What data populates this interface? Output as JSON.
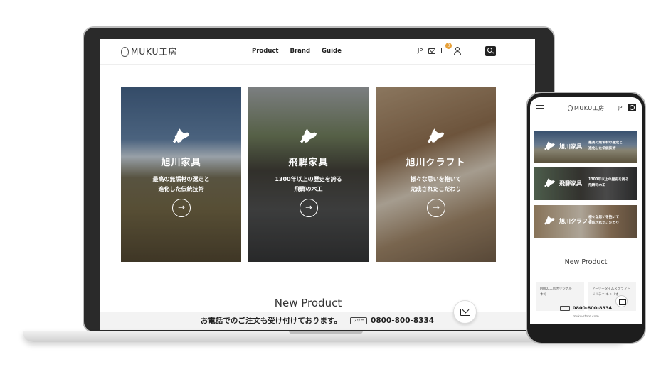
{
  "laptop": {
    "header": {
      "logo_text": "MUKU工房",
      "nav": [
        "Product",
        "Brand",
        "Guide"
      ],
      "lang": "JP",
      "cart_count": "0",
      "icons": [
        "mail-icon",
        "cart-icon",
        "user-icon",
        "search-icon"
      ]
    },
    "cards": [
      {
        "title": "旭川家具",
        "desc_line1": "最高の無垢材の選定と",
        "desc_line2": "進化した伝統技術",
        "arrow": "→"
      },
      {
        "title": "飛騨家具",
        "desc_line1": "1300年以上の歴史を誇る",
        "desc_line2": "飛騨の木工",
        "arrow": "→"
      },
      {
        "title": "旭川クラフト",
        "desc_line1": "様々な思いを抱いて",
        "desc_line2": "完成されたこだわり",
        "arrow": "→"
      }
    ],
    "new_product_title": "New Product",
    "phone_order": {
      "text": "お電話でのご注文も受け付けております。",
      "tel_icon_text": "フリー",
      "number": "0800-800-8334"
    }
  },
  "phone": {
    "logo_text": "MUKU工房",
    "lang": "JP",
    "cards": [
      {
        "title": "旭川家具",
        "desc_line1": "最高の無垢材の選定と",
        "desc_line2": "進化した伝統技術"
      },
      {
        "title": "飛騨家具",
        "desc_line1": "1300年以上の歴史を誇る",
        "desc_line2": "飛騨の木工"
      },
      {
        "title": "旭川クラフト",
        "desc_line1": "様々な思いを抱いて",
        "desc_line2": "完成されたこだわり"
      }
    ],
    "new_product_title": "New Product",
    "products": [
      {
        "line1": "MUKU工房オリジナル",
        "line2": "木札"
      },
      {
        "line1": "アーリータイムスクラフト",
        "line2": "ドルチェ キュリオ"
      }
    ],
    "phone_number": "0800-800-8334",
    "url": "muku-store.com"
  }
}
